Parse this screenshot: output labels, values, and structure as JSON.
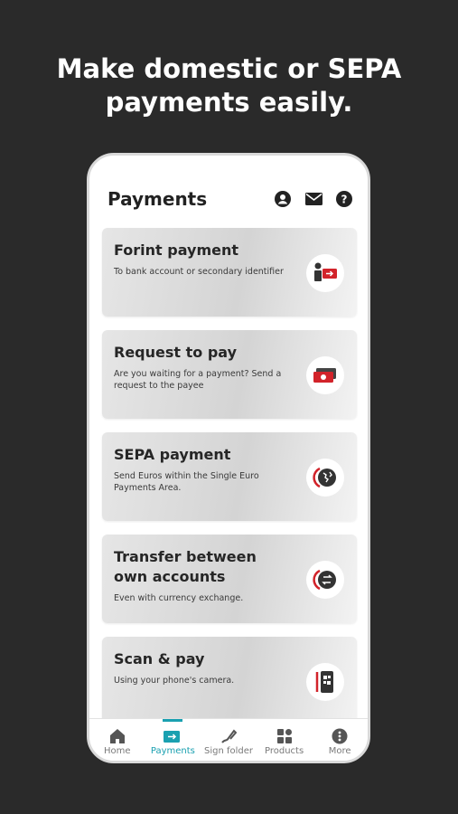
{
  "headline": {
    "line1": "Make domestic or SEPA",
    "line2": "payments easily."
  },
  "header": {
    "title": "Payments",
    "icons": [
      "profile-icon",
      "mail-icon",
      "help-icon"
    ]
  },
  "cards": [
    {
      "title": "Forint payment",
      "desc": "To bank account or secondary identifier",
      "icon": "person-card-icon"
    },
    {
      "title": "Request to pay",
      "desc": "Are you waiting for a payment? Send a request to the payee",
      "icon": "cash-request-icon"
    },
    {
      "title": "SEPA payment",
      "desc": "Send Euros within the Single Euro Payments Area.",
      "icon": "globe-icon"
    },
    {
      "title": "Transfer between own accounts",
      "desc": "Even with currency exchange.",
      "icon": "exchange-icon"
    },
    {
      "title": "Scan & pay",
      "desc": "Using your phone's camera.",
      "icon": "phone-scan-icon"
    }
  ],
  "nav": [
    {
      "label": "Home",
      "icon": "home-icon"
    },
    {
      "label": "Payments",
      "icon": "payments-icon",
      "active": true
    },
    {
      "label": "Sign folder",
      "icon": "sign-folder-icon"
    },
    {
      "label": "Products",
      "icon": "products-icon"
    },
    {
      "label": "More",
      "icon": "more-icon"
    }
  ],
  "colors": {
    "background": "#2a2a2a",
    "accent": "#1aa0b0",
    "brand_red": "#d2232a",
    "card_gray": "#d4d4d4"
  }
}
